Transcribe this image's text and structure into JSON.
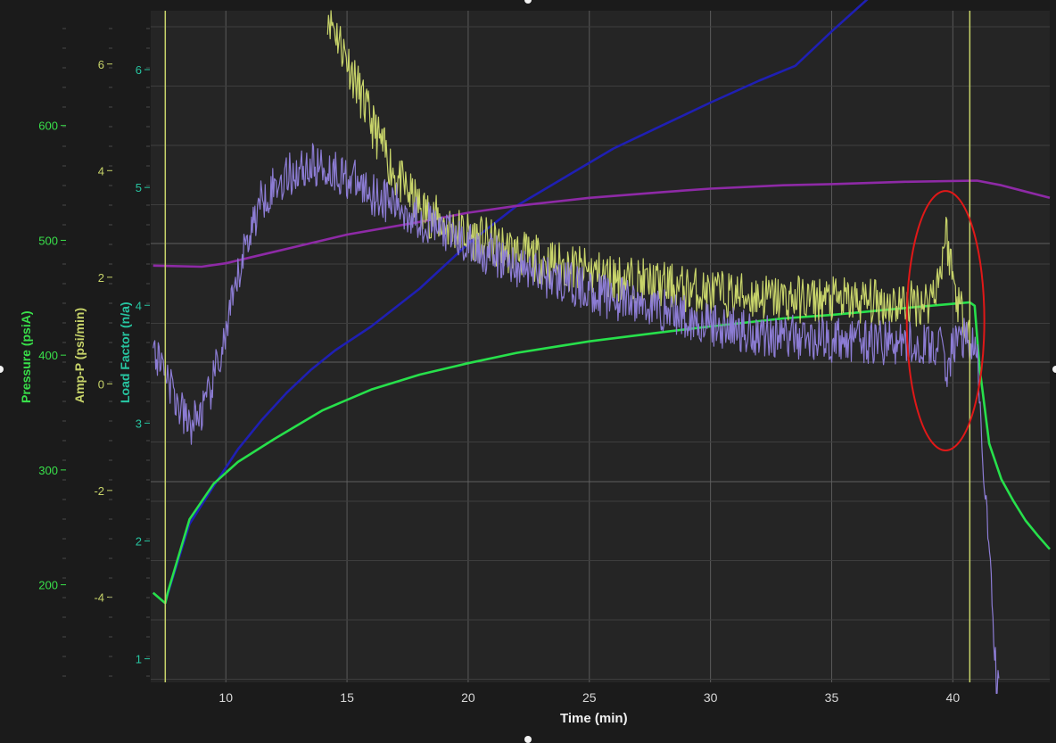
{
  "chart_data": {
    "type": "line",
    "xlabel": "Time   (min)",
    "xlim": [
      6.9,
      44.0
    ],
    "xticks": [
      10,
      15,
      20,
      25,
      30,
      35,
      40
    ],
    "grid": true,
    "legend": "none",
    "axes": {
      "pressure": {
        "label": "Pressure   (psiA)",
        "ticks": [
          200,
          300,
          400,
          500,
          600
        ],
        "range": [
          115,
          700
        ],
        "color": "#39e04a"
      },
      "amp_p": {
        "label": "Amp-P  (psi/min)",
        "ticks": [
          -4,
          -2,
          0,
          2,
          4,
          6
        ],
        "range": [
          -5.6,
          7.0
        ],
        "color": "#c8d46a"
      },
      "load_factor": {
        "label": "Load Factor  (n/a)",
        "ticks": [
          1,
          2,
          3,
          4,
          5,
          6
        ],
        "range": [
          0.8,
          6.5
        ],
        "color": "#27c4a0"
      }
    },
    "series": [
      {
        "axis": "pressure",
        "color": "#1f1fb3",
        "x": [
          7.5,
          8.5,
          9.5,
          10.5,
          11.5,
          12.5,
          13.5,
          14.5,
          16,
          18,
          20,
          22,
          24,
          26,
          28,
          30,
          32,
          33.5,
          35,
          37,
          39,
          40,
          41,
          42,
          43,
          44
        ],
        "y": [
          185,
          253,
          286,
          318,
          344,
          367,
          387,
          404,
          425,
          458,
          497,
          530,
          555,
          580,
          600,
          620,
          639,
          652,
          682,
          720,
          758,
          779,
          781,
          770,
          752,
          726
        ]
      },
      {
        "axis": "pressure",
        "color": "#8e2aa6",
        "x": [
          7,
          9,
          10,
          11,
          13,
          15,
          18,
          20,
          22,
          25,
          28,
          30,
          33,
          35,
          38,
          41,
          42,
          44
        ],
        "y": [
          478,
          477,
          480,
          485,
          495,
          505,
          516,
          524,
          530,
          537,
          542,
          545,
          548,
          549,
          551,
          552,
          548,
          537
        ]
      },
      {
        "axis": "pressure",
        "color": "#27e04b",
        "x": [
          7.0,
          7.5,
          7.6,
          8.5,
          9.5,
          10.5,
          12,
          14,
          16,
          18,
          20,
          22,
          25,
          28,
          30,
          33,
          35,
          38,
          40.7,
          40.9,
          41.1,
          41.5,
          42,
          42.5,
          43,
          43.5,
          44
        ],
        "y": [
          193,
          184,
          193,
          257,
          288,
          307,
          327,
          352,
          370,
          383,
          393,
          402,
          412,
          420,
          425,
          432,
          435,
          441,
          446,
          443,
          390,
          323,
          292,
          273,
          256,
          243,
          231
        ]
      },
      {
        "axis": "amp_p",
        "color": "#c8d46a",
        "noise": 0.45,
        "x": [
          14.2,
          15,
          16,
          17,
          18,
          19,
          20,
          22,
          24,
          26,
          28,
          30,
          33,
          36,
          38,
          39,
          39.5,
          39.7,
          39.9,
          40.1,
          40.4,
          40.7
        ],
        "y": [
          7.0,
          6.1,
          4.9,
          3.9,
          3.3,
          3.0,
          2.8,
          2.45,
          2.2,
          2.0,
          1.85,
          1.7,
          1.6,
          1.55,
          1.5,
          1.55,
          2.1,
          2.9,
          2.3,
          1.75,
          1.3,
          1.1
        ]
      },
      {
        "axis": "amp_p",
        "color": "#8c7cd4",
        "noise": 0.42,
        "x": [
          7,
          7.5,
          8.0,
          8.5,
          9.2,
          10.0,
          10.8,
          11.5,
          12.5,
          13.5,
          14.5,
          16,
          18,
          20,
          22,
          24,
          26,
          28,
          30,
          32,
          34,
          36,
          38,
          39.5,
          39.7,
          40.0,
          40.5,
          41.0,
          41.4,
          41.8,
          41.9
        ],
        "y": [
          0.6,
          0.3,
          -0.4,
          -0.8,
          -0.4,
          0.9,
          2.6,
          3.5,
          3.9,
          4.1,
          4.0,
          3.6,
          3.1,
          2.6,
          2.2,
          1.9,
          1.6,
          1.4,
          1.1,
          0.95,
          0.85,
          0.8,
          0.75,
          0.7,
          0.2,
          0.7,
          0.9,
          0.5,
          -2.5,
          -5.5,
          -5.6
        ]
      }
    ],
    "vertical_markers": {
      "x": [
        7.5,
        40.7
      ],
      "color": "#c8d46a"
    },
    "annotations": [
      {
        "shape": "ellipse",
        "color": "#e01818",
        "center_x": 39.7,
        "center_pressure": 430,
        "radius_min": 1.6,
        "radius_psi": 113
      }
    ]
  }
}
